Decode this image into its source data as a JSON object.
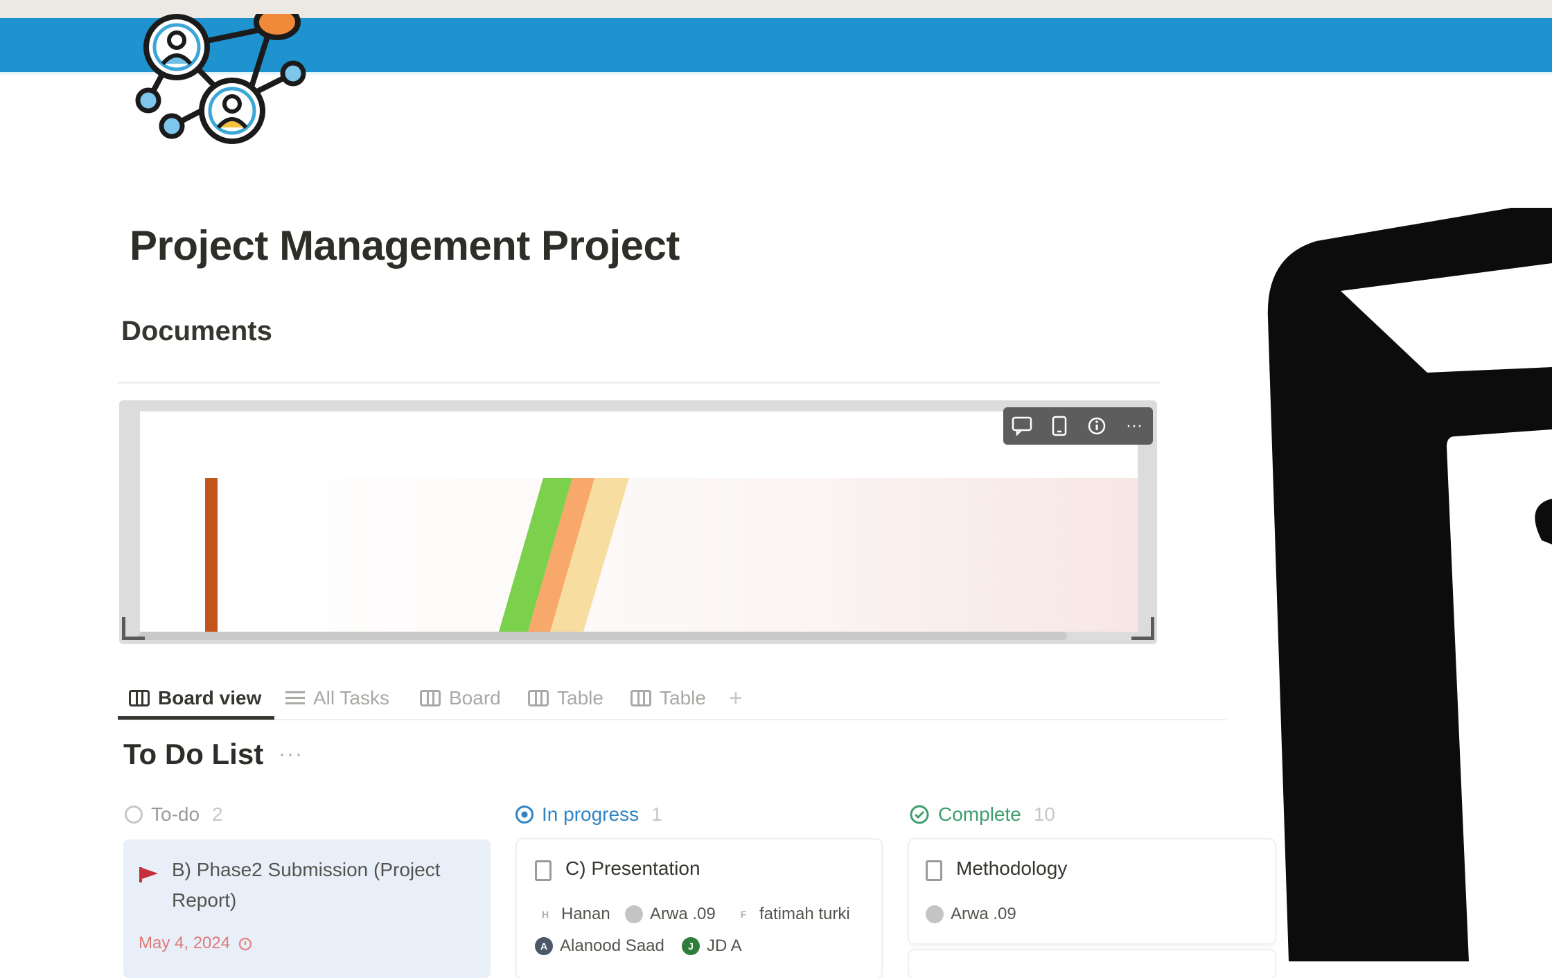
{
  "page": {
    "title": "Project Management Project",
    "section_heading": "Documents"
  },
  "colors": {
    "banner": "#1f93cf",
    "embed_bar_orange": "#c4551a",
    "embed_stripe_green": "#7bd04c",
    "embed_stripe_yellow": "#f7dea0",
    "flag_red": "#c62e3a",
    "progress_blue": "#2f83c2",
    "complete_green": "#3f9e6e",
    "todo_card_bg": "#e8eff8"
  },
  "embed": {
    "toolbar": [
      "comment-icon",
      "mobile-icon",
      "info-icon",
      "more-icon"
    ],
    "more_glyph": "···"
  },
  "tabs": [
    {
      "label": "Board view",
      "icon": "board-icon",
      "active": true
    },
    {
      "label": "All Tasks",
      "icon": "list-icon",
      "active": false
    },
    {
      "label": "Board",
      "icon": "board-icon",
      "active": false
    },
    {
      "label": "Table",
      "icon": "table-icon",
      "active": false
    },
    {
      "label": "Table",
      "icon": "table-icon",
      "active": false
    }
  ],
  "tabs_add": "+",
  "board": {
    "title": "To Do List",
    "more": "···",
    "columns": [
      {
        "label": "To-do",
        "count": "2",
        "cards": [
          {
            "title_line1": "B) Phase2 Submission (Project",
            "title_line2": "Report)",
            "date": "May 4, 2024"
          }
        ]
      },
      {
        "label": "In progress",
        "count": "1",
        "cards": [
          {
            "title": "C) Presentation",
            "people": [
              {
                "initial": "H",
                "name": "Hanan"
              },
              {
                "initial": "",
                "name": "Arwa .09"
              },
              {
                "initial": "F",
                "name": "fatimah turki"
              },
              {
                "initial": "A",
                "name": "Alanood Saad"
              },
              {
                "initial": "J",
                "name": "JD A"
              }
            ]
          }
        ]
      },
      {
        "label": "Complete",
        "count": "10",
        "cards": [
          {
            "title": "Methodology",
            "people": [
              {
                "initial": "",
                "name": "Arwa .09"
              }
            ]
          }
        ]
      }
    ]
  }
}
